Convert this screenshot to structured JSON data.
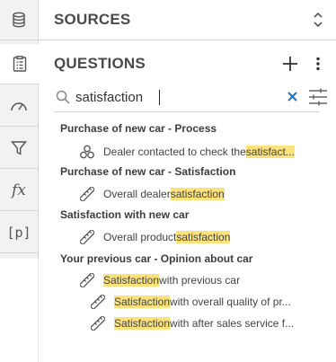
{
  "rail": {
    "fx_label": "fx",
    "param_label": "[p]"
  },
  "sources": {
    "title": "SOURCES"
  },
  "questions": {
    "title": "QUESTIONS",
    "search": {
      "value": "satisfaction"
    },
    "groups": [
      {
        "title": "Purchase of new car - Process",
        "items": [
          {
            "icon": "network-icon",
            "pre": "Dealer contacted to check the ",
            "match": "satisfact...",
            "post": ""
          }
        ]
      },
      {
        "title": "Purchase of new car - Satisfaction",
        "items": [
          {
            "icon": "ruler-icon",
            "pre": "Overall dealer ",
            "match": "satisfaction",
            "post": ""
          }
        ]
      },
      {
        "title": "Satisfaction with new car",
        "items": [
          {
            "icon": "ruler-icon",
            "pre": "Overall product ",
            "match": "satisfaction",
            "post": ""
          }
        ]
      },
      {
        "title": "Your previous car - Opinion about car",
        "items": [
          {
            "icon": "ruler-icon",
            "pre": "",
            "match": "Satisfaction",
            "post": " with previous car"
          },
          {
            "icon": "ruler-icon",
            "pre": "",
            "match": "Satisfaction",
            "post": " with overall quality of pr..."
          },
          {
            "icon": "ruler-icon",
            "pre": "",
            "match": "Satisfaction",
            "post": " with after sales service f..."
          }
        ]
      }
    ]
  },
  "colors": {
    "highlight": "#fbe27a",
    "clear_x": "#1a73c8",
    "rail_bg": "#f2f2f2"
  }
}
